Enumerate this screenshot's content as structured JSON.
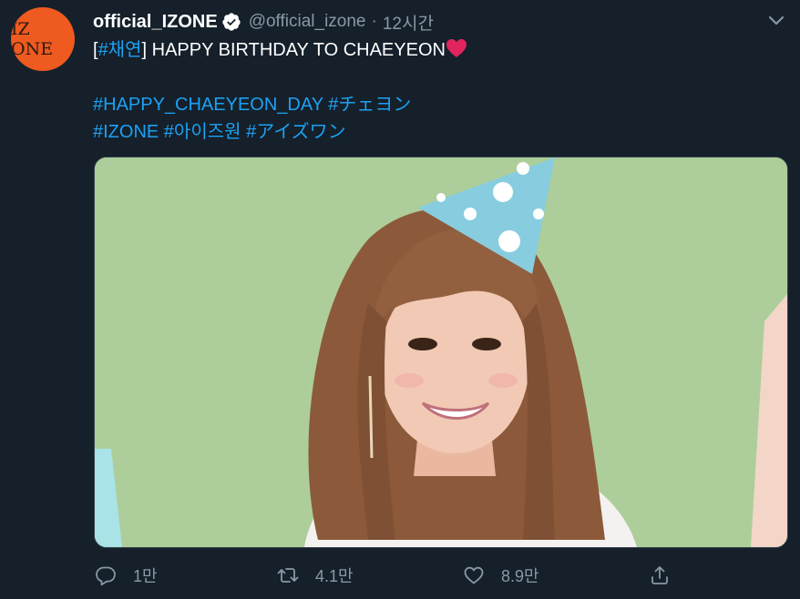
{
  "tweet": {
    "avatar_text": "IZ ONE",
    "display_name": "official_IZONE",
    "handle": "@official_izone",
    "separator": "·",
    "time": "12시간",
    "line1": {
      "open_bracket": "[",
      "hashtag": "#채연",
      "close_bracket": "]",
      "text": " HAPPY BIRTHDAY TO CHAEYEON"
    },
    "line3": "#HAPPY_CHAEYEON_DAY #チェヨン",
    "line4": "#IZONE #아이즈원 #アイズワン"
  },
  "actions": {
    "reply_count": "1만",
    "retweet_count": "4.1만",
    "like_count": "8.9만"
  },
  "icons": {
    "verified": "verified-badge-icon",
    "caret": "chevron-down-icon",
    "heart": "red-heart-emoji",
    "reply": "reply-icon",
    "retweet": "retweet-icon",
    "like": "heart-icon",
    "share": "share-icon"
  },
  "colors": {
    "background": "#15202b",
    "text": "#ffffff",
    "secondary": "#8899a6",
    "link": "#1da1f2",
    "avatar": "#ee5a1f",
    "heart": "#e0245e"
  }
}
